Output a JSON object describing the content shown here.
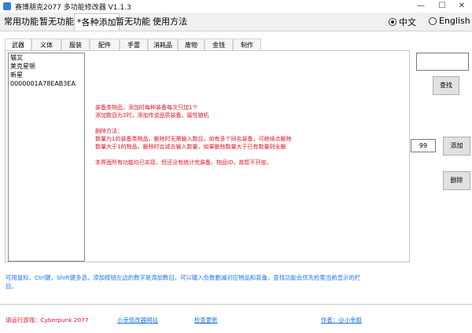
{
  "window": {
    "title": "赛博朋克2077 多功能修改器 V1.1.3",
    "icon": "app-icon"
  },
  "main_tabs": [
    {
      "label": "常用功能",
      "active": false
    },
    {
      "label": "暂无功能",
      "active": false
    },
    {
      "label": "*各种添加",
      "active": true
    },
    {
      "label": "暂无功能",
      "active": false
    },
    {
      "label": "使用方法",
      "active": false
    }
  ],
  "language": {
    "options": [
      {
        "label": "中文",
        "selected": true
      },
      {
        "label": "English",
        "selected": false
      }
    ]
  },
  "sub_tabs": [
    {
      "label": "武器",
      "active": true
    },
    {
      "label": "义体",
      "active": false
    },
    {
      "label": "服装",
      "active": false
    },
    {
      "label": "配件",
      "active": false
    },
    {
      "label": "手雷",
      "active": false
    },
    {
      "label": "消耗品",
      "active": false
    },
    {
      "label": "废物",
      "active": false
    },
    {
      "label": "金钱",
      "active": false
    },
    {
      "label": "制作",
      "active": false
    }
  ],
  "item_list": [
    "猫又",
    "莱克星顿",
    "新星",
    "0000001A78EAB3EA"
  ],
  "info_text": {
    "line1": "装备类物品，添加时每种装备每次只加1个",
    "line2": "添加数目为2时，添加传说品质装备，属性随机",
    "line3": "删除方法：",
    "line4": "数量为1的装备类物品，删除时无需输入数目，如有多个同名装备，可继续点删除",
    "line5": "数量大于1的物品，删除时会减去输入数量，如果删除数量大于已有数量则全删",
    "line6": "本界面所有功能均已实现，但还没有统计完装备、物品ID，故暂不开放。"
  },
  "controls": {
    "search_value": "",
    "find_label": "查找",
    "quantity_value": "99",
    "add_label": "添加",
    "delete_label": "删除"
  },
  "hint_text": "可用鼠标、Ctrl键、Shift键多选，添加按钮左边的数字是添加数目，可以输入负数删减对应物品和装备，查找功能会优先检索当前显示的栏目。",
  "footer": {
    "status": "请运行游戏：Cyberpunk 2077",
    "link_site": "小幸修改器网站",
    "link_update": "检查更新",
    "link_author": "作者：@小幸姐"
  },
  "colors": {
    "info_red": "#e81123",
    "hint_blue": "#1a73e8"
  }
}
